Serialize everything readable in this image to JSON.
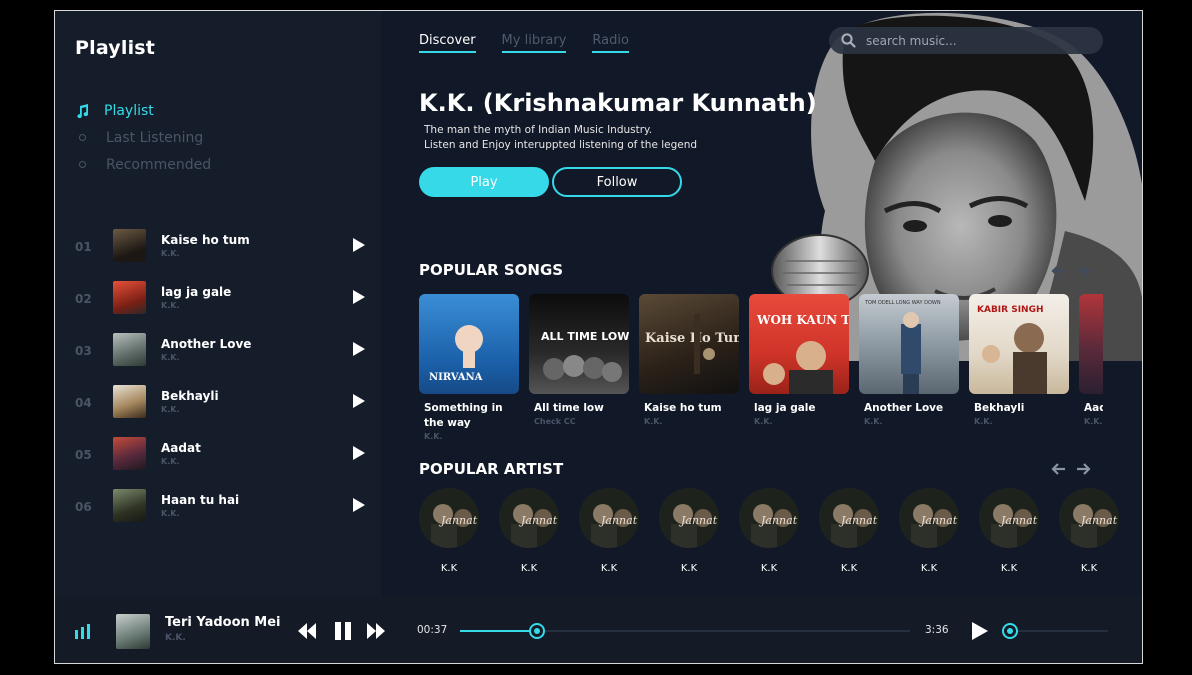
{
  "sidebar": {
    "title": "Playlist",
    "nav": [
      {
        "label": "Playlist",
        "active": true
      },
      {
        "label": "Last Listening",
        "active": false
      },
      {
        "label": "Recommended",
        "active": false
      }
    ],
    "tracks": [
      {
        "num": "01",
        "title": "Kaise ho tum",
        "artist": "K.K."
      },
      {
        "num": "02",
        "title": "lag ja gale",
        "artist": "K.K."
      },
      {
        "num": "03",
        "title": "Another Love",
        "artist": "K.K."
      },
      {
        "num": "04",
        "title": "Bekhayli",
        "artist": "K.K."
      },
      {
        "num": "05",
        "title": "Aadat",
        "artist": "K.K."
      },
      {
        "num": "06",
        "title": "Haan tu hai",
        "artist": "K.K."
      }
    ]
  },
  "header": {
    "tabs": [
      {
        "label": "Discover",
        "active": true
      },
      {
        "label": "My library",
        "active": false
      },
      {
        "label": "Radio",
        "active": false
      }
    ],
    "search_placeholder": "search music..."
  },
  "hero": {
    "title": "K.K. (Krishnakumar Kunnath)",
    "subtitle_line1": "The man the myth of Indian Music Industry.",
    "subtitle_line2": "Listen and Enjoy interuppted listening of the legend",
    "play_label": "Play",
    "follow_label": "Follow"
  },
  "popular_songs": {
    "title": "POPULAR SONGS",
    "items": [
      {
        "title": "Something in the way",
        "artist": "K.K.",
        "cover_text": "NIRVANA"
      },
      {
        "title": "All time low",
        "artist": "Check CC",
        "cover_text": "ALL TIME LOW"
      },
      {
        "title": "Kaise ho tum",
        "artist": "K.K.",
        "cover_text": "Kaise Ho Tum"
      },
      {
        "title": "lag ja gale",
        "artist": "K.K.",
        "cover_text": "WOH KAUN THI?"
      },
      {
        "title": "Another Love",
        "artist": "K.K.",
        "cover_text": "TOM ODELL LONG WAY DOWN"
      },
      {
        "title": "Bekhayli",
        "artist": "K.K.",
        "cover_text": "KABIR SINGH"
      },
      {
        "title": "Aad",
        "artist": "K.K.",
        "cover_text": ""
      }
    ]
  },
  "popular_artist": {
    "title": "POPULAR ARTIST",
    "items": [
      {
        "name": "K.K",
        "cover_text": "Jannat"
      },
      {
        "name": "K.K",
        "cover_text": "Jannat"
      },
      {
        "name": "K.K",
        "cover_text": "Jannat"
      },
      {
        "name": "K.K",
        "cover_text": "Jannat"
      },
      {
        "name": "K.K",
        "cover_text": "Jannat"
      },
      {
        "name": "K.K",
        "cover_text": "Jannat"
      },
      {
        "name": "K.K",
        "cover_text": "Jannat"
      },
      {
        "name": "K.K",
        "cover_text": "Jannat"
      },
      {
        "name": "K.K",
        "cover_text": "Jannat"
      }
    ]
  },
  "player": {
    "title": "Teri Yadoon Mei",
    "artist": "K.K.",
    "current_time": "00:37",
    "total_time": "3:36",
    "progress": 0.17,
    "volume": 0
  },
  "colors": {
    "accent": "#35d9e8",
    "background": "#111827",
    "sidebar": "#161d2a",
    "muted": "#4a5467"
  }
}
